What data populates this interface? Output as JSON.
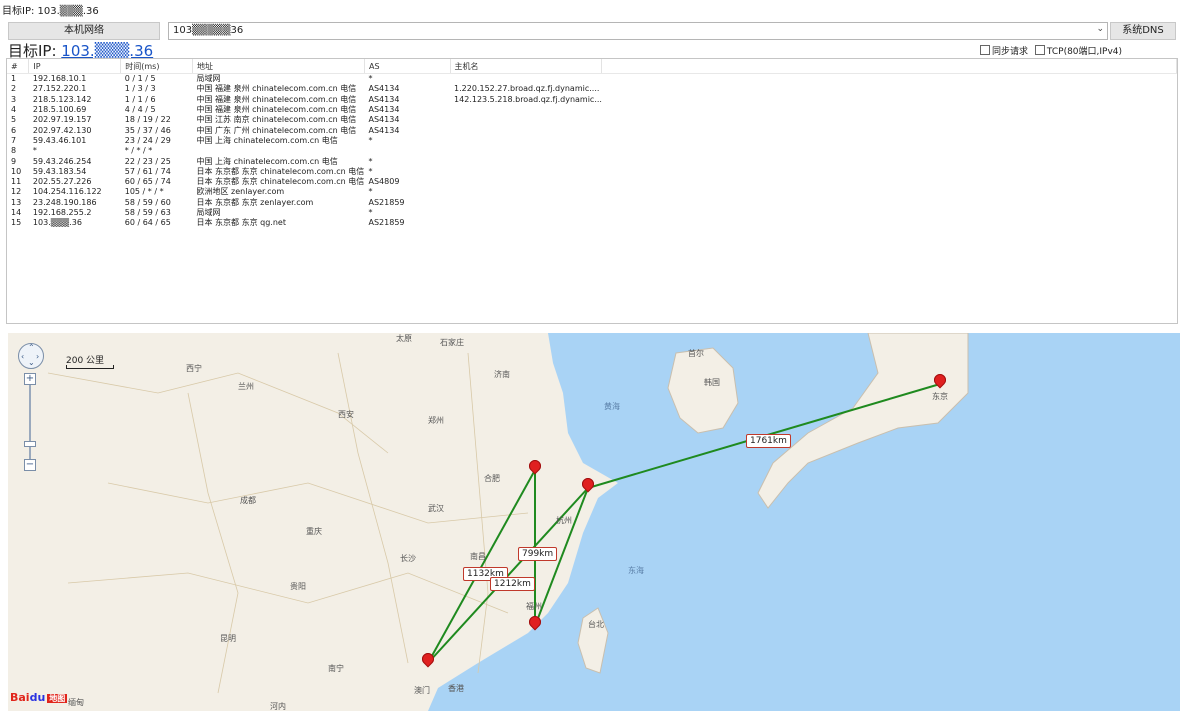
{
  "window": {
    "title": "目标IP: 103.▒▒▒.36"
  },
  "toolbar": {
    "local_network_label": "本机网络",
    "target_combo_value": "103▒▒▒▒▒36",
    "system_dns_label": "系统DNS"
  },
  "target": {
    "prefix": "目标IP: ",
    "ip": "103.▒▒▒.36"
  },
  "options": {
    "sync_request": "同步请求",
    "tcp_mode": "TCP(80端口,IPv4)"
  },
  "table": {
    "headers": [
      "#",
      "IP",
      "时间(ms)",
      "地址",
      "AS",
      "主机名"
    ],
    "rows": [
      [
        "1",
        "192.168.10.1",
        "0 / 1 / 5",
        "局域网",
        "*",
        ""
      ],
      [
        "2",
        "27.152.220.1",
        "1 / 3 / 3",
        "中国 福建 泉州 chinatelecom.com.cn 电信",
        "AS4134",
        "1.220.152.27.broad.qz.fj.dynamic...."
      ],
      [
        "3",
        "218.5.123.142",
        "1 / 1 / 6",
        "中国 福建 泉州 chinatelecom.com.cn 电信",
        "AS4134",
        "142.123.5.218.broad.qz.fj.dynamic..."
      ],
      [
        "4",
        "218.5.100.69",
        "4 / 4 / 5",
        "中国 福建 泉州 chinatelecom.com.cn 电信",
        "AS4134",
        ""
      ],
      [
        "5",
        "202.97.19.157",
        "18 / 19 / 22",
        "中国 江苏 南京 chinatelecom.com.cn 电信",
        "AS4134",
        ""
      ],
      [
        "6",
        "202.97.42.130",
        "35 / 37 / 46",
        "中国 广东 广州 chinatelecom.com.cn 电信",
        "AS4134",
        ""
      ],
      [
        "7",
        "59.43.46.101",
        "23 / 24 / 29",
        "中国 上海 chinatelecom.com.cn 电信",
        "*",
        ""
      ],
      [
        "8",
        "*",
        "* / * / *",
        "",
        "",
        ""
      ],
      [
        "9",
        "59.43.246.254",
        "22 / 23 / 25",
        "中国 上海 chinatelecom.com.cn 电信",
        "*",
        ""
      ],
      [
        "10",
        "59.43.183.54",
        "57 / 61 / 74",
        "日本 东京都 东京 chinatelecom.com.cn 电信",
        "*",
        ""
      ],
      [
        "11",
        "202.55.27.226",
        "60 / 65 / 74",
        "日本 东京都 东京 chinatelecom.com.cn 电信",
        "AS4809",
        ""
      ],
      [
        "12",
        "104.254.116.122",
        "105 / * / *",
        "欧洲地区 zenlayer.com",
        "*",
        ""
      ],
      [
        "13",
        "23.248.190.186",
        "58 / 59 / 60",
        "日本 东京都 东京 zenlayer.com",
        "AS21859",
        ""
      ],
      [
        "14",
        "192.168.255.2",
        "58 / 59 / 63",
        "局域网",
        "*",
        ""
      ],
      [
        "15",
        "103.▒▒▒.36",
        "60 / 64 / 65",
        "日本 东京都 东京 qg.net",
        "AS21859",
        ""
      ]
    ]
  },
  "map": {
    "scale_label": "200 公里",
    "logo": {
      "bai": "Bai",
      "du": "du",
      "map": "地图"
    },
    "distances": [
      "1761km",
      "799km",
      "1132km",
      "1212km"
    ],
    "places": [
      "太原",
      "石家庄",
      "西宁",
      "兰州",
      "济南",
      "首尔",
      "韩国",
      "黄海",
      "西安",
      "郑州",
      "合肥",
      "成都",
      "武汉",
      "杭州",
      "重庆",
      "长沙",
      "南昌",
      "东海",
      "贵阳",
      "福州",
      "台北",
      "昆明",
      "南宁",
      "澳门",
      "香港",
      "东京",
      "河内",
      "缅甸"
    ],
    "route_color": "#1f8a1f",
    "pin_color": "#e02020",
    "sea_color": "#a9d3f5"
  }
}
